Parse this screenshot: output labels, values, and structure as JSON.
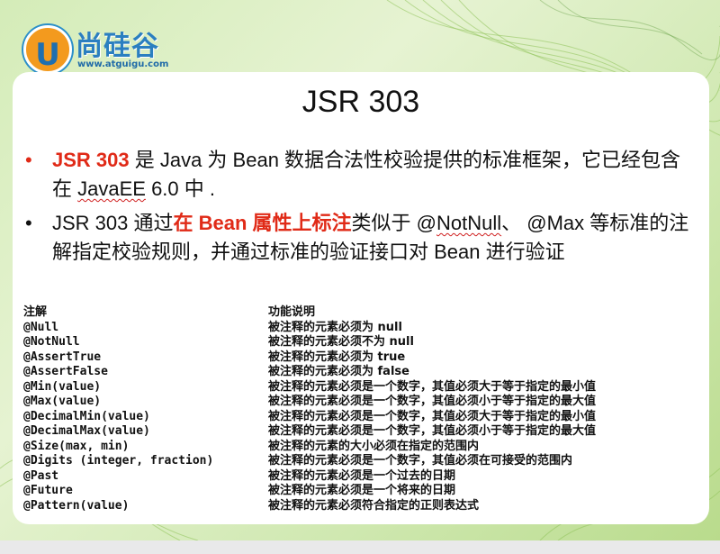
{
  "brand": {
    "name": "尚硅谷",
    "logo_letter": "U",
    "url": "www.atguigu.com"
  },
  "colors": {
    "accent_red": "#e02a17",
    "logo_orange": "#f39a1e",
    "logo_blue": "#2b7fc0"
  },
  "slide": {
    "title": "JSR 303",
    "bullets": [
      {
        "dot": "•",
        "parts": [
          {
            "text": "JSR 303",
            "style": "hl"
          },
          {
            "text": " 是 Java 为 Bean 数据合法性校验提供的标准框架，它已经包含在 ",
            "style": ""
          },
          {
            "text": "JavaEE",
            "style": "squig"
          },
          {
            "text": " 6.0 中 .",
            "style": ""
          }
        ]
      },
      {
        "dot": "•",
        "parts": [
          {
            "text": "JSR 303 通过",
            "style": ""
          },
          {
            "text": "在 Bean 属性上标注",
            "style": "hl"
          },
          {
            "text": "类似于 @",
            "style": ""
          },
          {
            "text": "NotNull",
            "style": "squig"
          },
          {
            "text": "、 @Max 等标准的注解指定校验规则，并通过标准的验证接口对 Bean 进行验证",
            "style": ""
          }
        ]
      }
    ],
    "table": {
      "headers": [
        "注解",
        "功能说明"
      ],
      "rows": [
        [
          "@Null",
          "被注释的元素必须为 null"
        ],
        [
          "@NotNull",
          "被注释的元素必须不为 null"
        ],
        [
          "@AssertTrue",
          "被注释的元素必须为 true"
        ],
        [
          "@AssertFalse",
          "被注释的元素必须为 false"
        ],
        [
          "@Min(value)",
          "被注释的元素必须是一个数字，其值必须大于等于指定的最小值"
        ],
        [
          "@Max(value)",
          "被注释的元素必须是一个数字，其值必须小于等于指定的最大值"
        ],
        [
          "@DecimalMin(value)",
          "被注释的元素必须是一个数字，其值必须大于等于指定的最小值"
        ],
        [
          "@DecimalMax(value)",
          "被注释的元素必须是一个数字，其值必须小于等于指定的最大值"
        ],
        [
          "@Size(max, min)",
          "被注释的元素的大小必须在指定的范围内"
        ],
        [
          "@Digits (integer, fraction)",
          "被注释的元素必须是一个数字，其值必须在可接受的范围内"
        ],
        [
          "@Past",
          "被注释的元素必须是一个过去的日期"
        ],
        [
          "@Future",
          "被注释的元素必须是一个将来的日期"
        ],
        [
          "@Pattern(value)",
          "被注释的元素必须符合指定的正则表达式"
        ]
      ]
    }
  }
}
